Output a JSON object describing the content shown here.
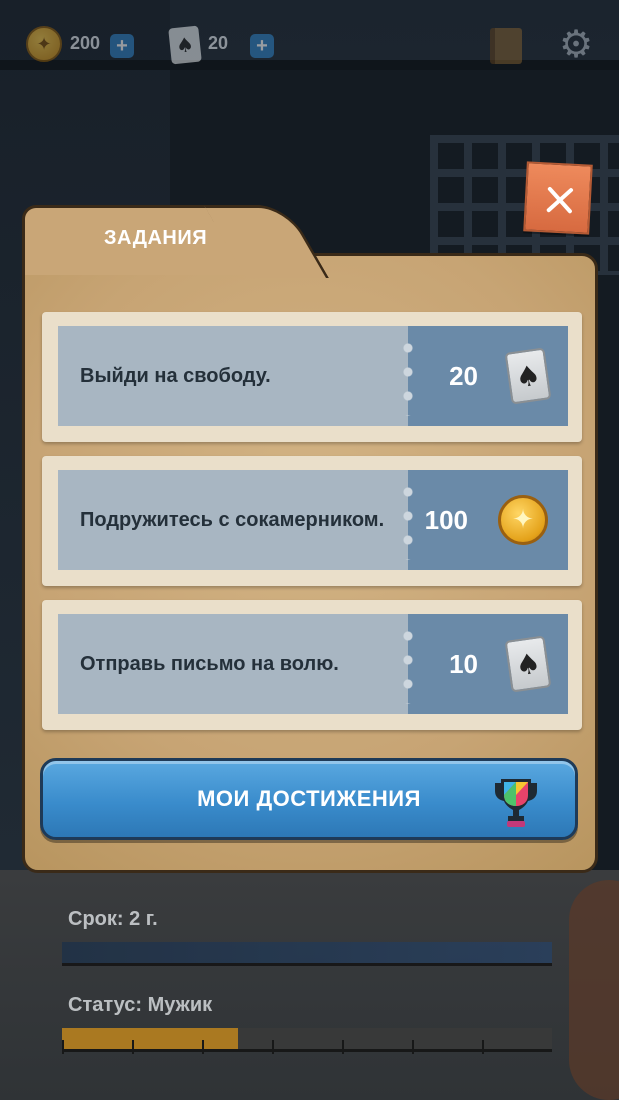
{
  "hud": {
    "coins": "200",
    "cards": "20",
    "coin_icon": "coin-icon",
    "card_icon": "spade-card-icon",
    "journal_icon": "book-icon",
    "settings_icon": "gear-icon"
  },
  "panel": {
    "title": "ЗАДАНИЯ",
    "tasks": [
      {
        "text": "Выйди на свободу.",
        "reward": "20",
        "reward_type": "card"
      },
      {
        "text": "Подружитесь с сокамерником.",
        "reward": "100",
        "reward_type": "coin"
      },
      {
        "text": "Отправь письмо на волю.",
        "reward": "10",
        "reward_type": "card"
      }
    ],
    "achievements_label": "МОИ ДОСТИЖЕНИЯ",
    "achievements_icon": "trophy-icon",
    "close_icon": "close-icon"
  },
  "status": {
    "term_label": "Срок: 2 г.",
    "term_progress": 1.0,
    "status_label": "Статус: Мужик",
    "status_progress": 0.36
  },
  "colors": {
    "accent_button": "#3a8ccc",
    "close_button": "#e07a4c",
    "folder": "#c9a677",
    "ticket_panel": "#a8b6c2",
    "reward_panel": "#6a8aa8"
  }
}
